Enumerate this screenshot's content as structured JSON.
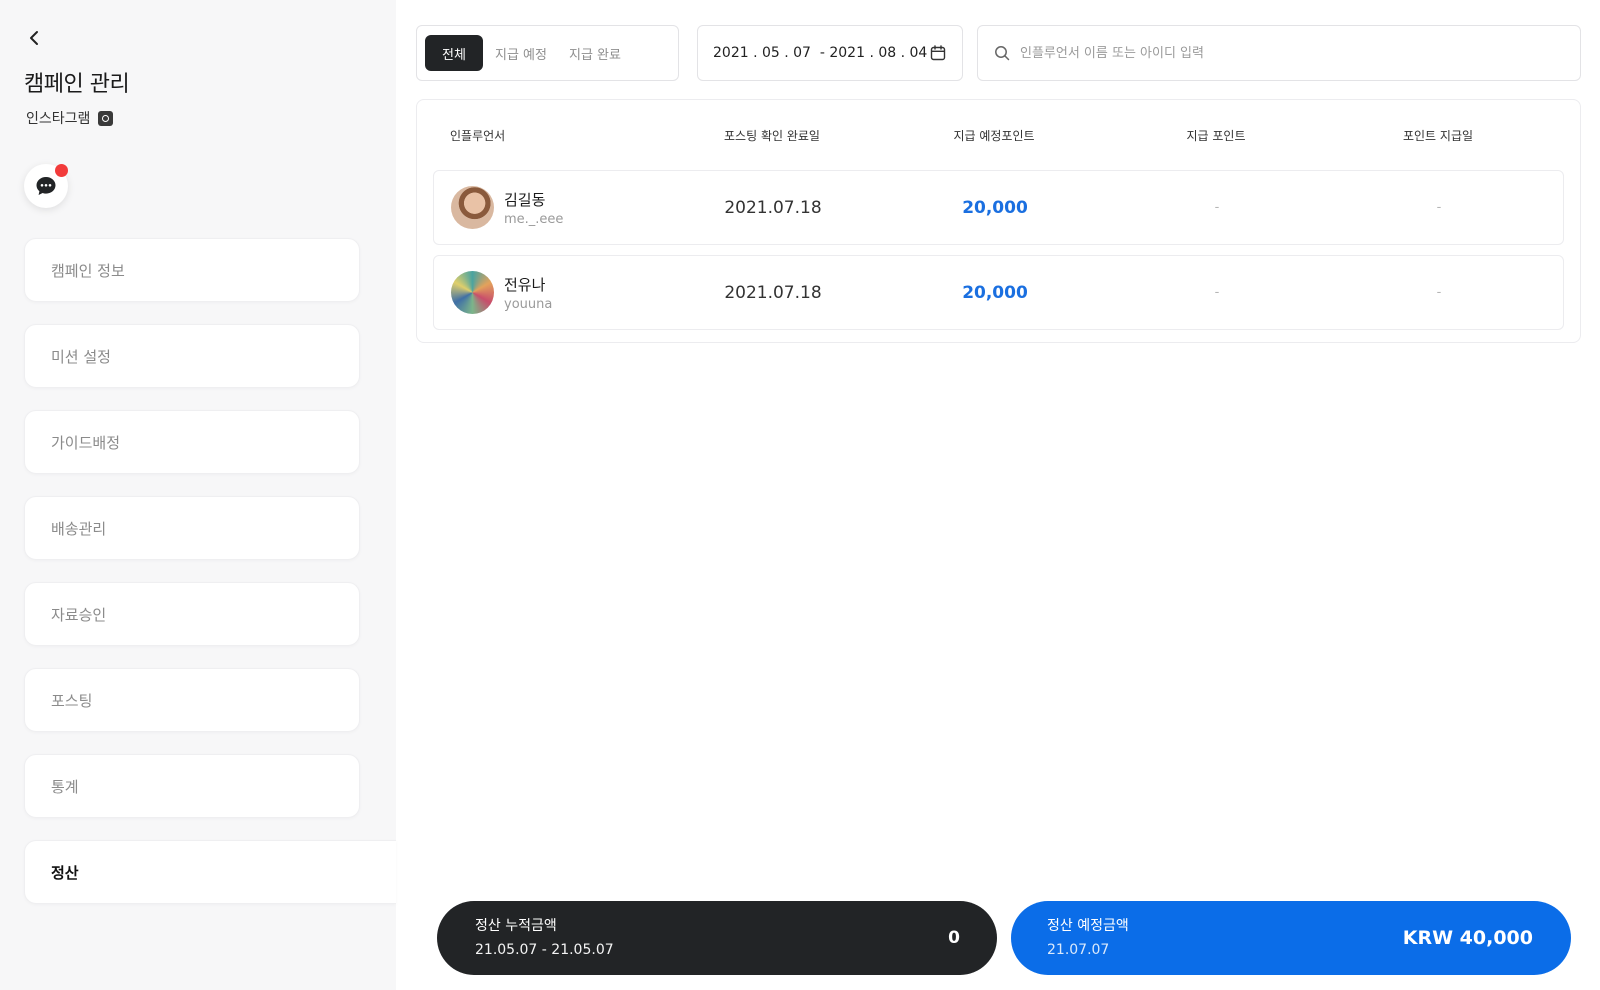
{
  "sidebar": {
    "title": "캠페인 관리",
    "platform": "인스타그램",
    "items": [
      {
        "label": "캠페인 정보"
      },
      {
        "label": "미션 설정"
      },
      {
        "label": "가이드배정"
      },
      {
        "label": "배송관리"
      },
      {
        "label": "자료승인"
      },
      {
        "label": "포스팅"
      },
      {
        "label": "통계"
      },
      {
        "label": "정산"
      }
    ],
    "active_item": "정산"
  },
  "filters": {
    "tabs": [
      {
        "label": "전체",
        "active": true
      },
      {
        "label": "지급 예정",
        "active": false
      },
      {
        "label": "지급 완료",
        "active": false
      }
    ],
    "date_range": "2021 . 05 . 07  - 2021 . 08 . 04",
    "search_placeholder": "인플루언서 이름 또는 아이디 입력",
    "search_value": ""
  },
  "table": {
    "headers": {
      "influencer": "인플루언서",
      "posting_date": "포스팅 확인 완료일",
      "expected_points": "지급 예정포인트",
      "paid_points": "지급 포인트",
      "payment_date": "포인트 지급일"
    },
    "rows": [
      {
        "name": "김길동",
        "handle": "me._.eee",
        "posting_date": "2021.07.18",
        "expected_points": "20,000",
        "paid_points": "-",
        "payment_date": "-"
      },
      {
        "name": "전유나",
        "handle": "youuna",
        "posting_date": "2021.07.18",
        "expected_points": "20,000",
        "paid_points": "-",
        "payment_date": "-"
      }
    ]
  },
  "summary": {
    "accumulated": {
      "label": "정산 누적금액",
      "period": "21.05.07 - 21.05.07",
      "value": "0"
    },
    "expected": {
      "label": "정산 예정금액",
      "date": "21.07.07",
      "value": "KRW 40,000"
    }
  },
  "colors": {
    "accent_blue": "#0b6de8",
    "points_blue": "#1a6fe0",
    "dark": "#222426",
    "notification_red": "#f23b3b",
    "sidebar_bg": "#f7f7f8"
  },
  "icons": [
    "chevron-left-icon",
    "instagram-icon",
    "chat-icon",
    "calendar-icon",
    "search-icon"
  ]
}
